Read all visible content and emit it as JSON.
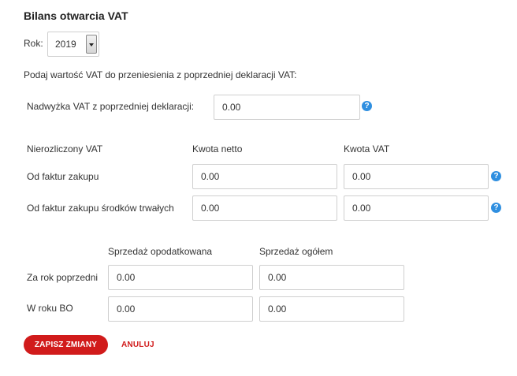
{
  "page": {
    "title": "Bilans otwarcia VAT"
  },
  "year": {
    "label": "Rok:",
    "selected": "2019"
  },
  "instruction": "Podaj wartość VAT do przeniesienia z poprzedniej deklaracji VAT:",
  "surplus": {
    "label": "Nadwyżka VAT z poprzedniej deklaracji:",
    "value": "0.00",
    "help": "?"
  },
  "unsettled": {
    "header": {
      "col1": "Nierozliczony VAT",
      "col2": "Kwota netto",
      "col3": "Kwota VAT"
    },
    "rows": [
      {
        "label": "Od faktur zakupu",
        "netto": "0.00",
        "vat": "0.00",
        "help": "?"
      },
      {
        "label": "Od faktur zakupu środków trwałych",
        "netto": "0.00",
        "vat": "0.00",
        "help": "?"
      }
    ]
  },
  "sales": {
    "header": {
      "col1": "Sprzedaż opodatkowana",
      "col2": "Sprzedaż ogółem"
    },
    "rows": [
      {
        "label": "Za rok poprzedni",
        "taxed": "0.00",
        "total": "0.00"
      },
      {
        "label": "W roku BO",
        "taxed": "0.00",
        "total": "0.00"
      }
    ]
  },
  "actions": {
    "save": "ZAPISZ ZMIANY",
    "cancel": "ANULUJ"
  },
  "colors": {
    "accent": "#d11b1b",
    "help": "#2f8fe0"
  }
}
